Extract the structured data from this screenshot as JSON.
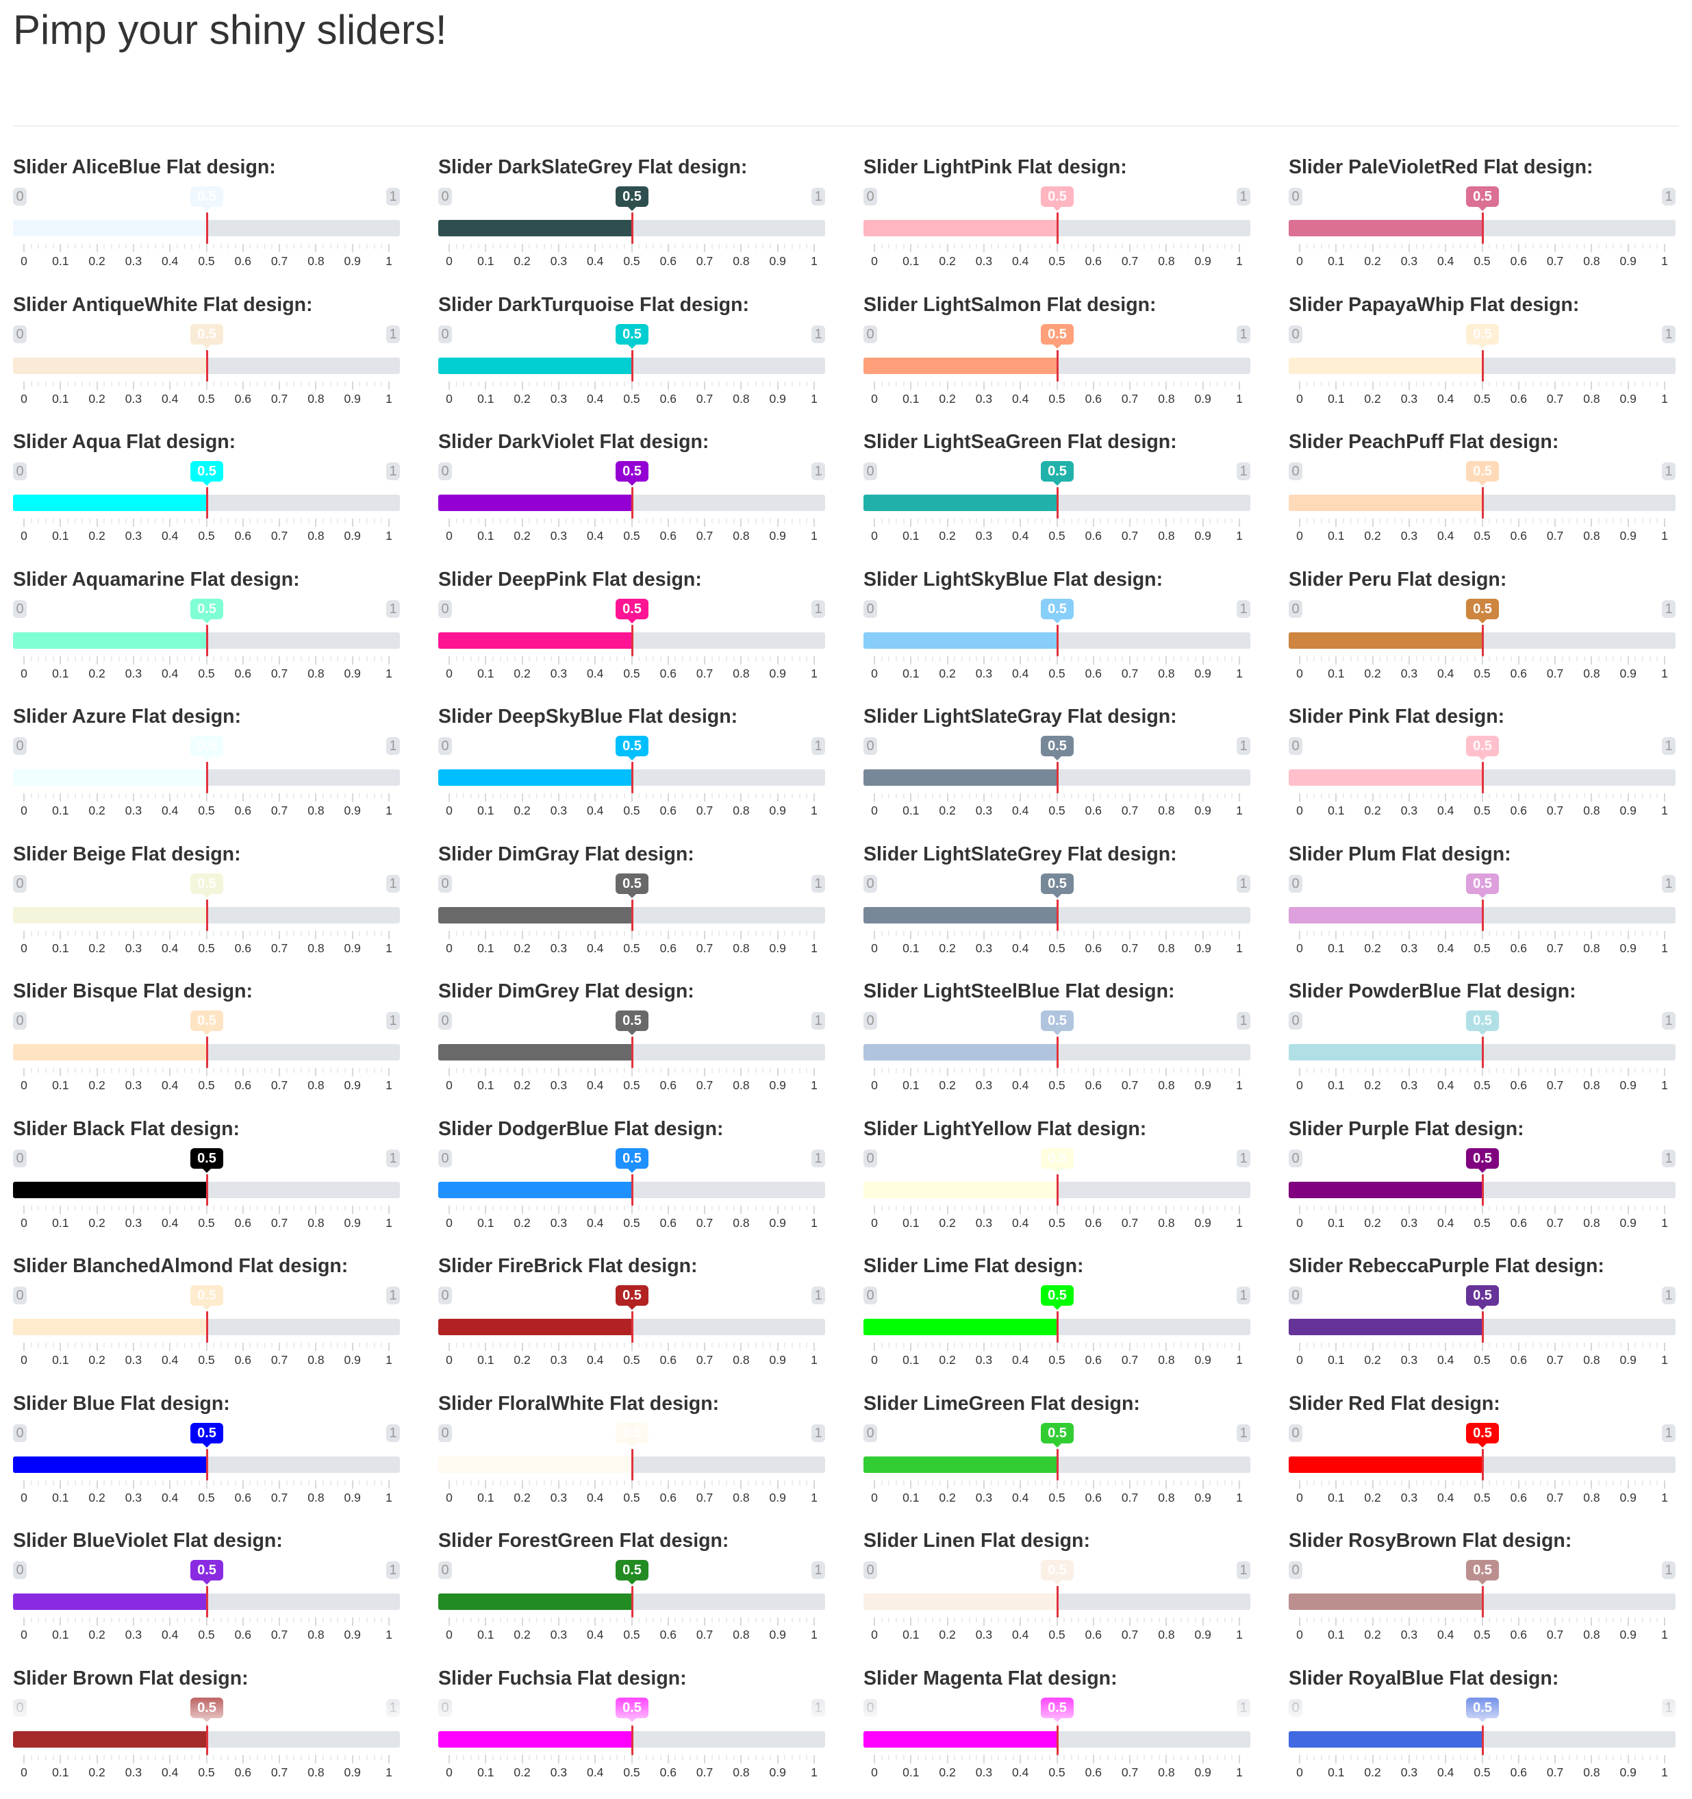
{
  "page": {
    "title": "Pimp your shiny sliders!"
  },
  "slider_common": {
    "min_label": "0",
    "max_label": "1",
    "value_label": "0.5",
    "value": 0.5,
    "scale_labels": [
      "0",
      "0.1",
      "0.2",
      "0.3",
      "0.4",
      "0.5",
      "0.6",
      "0.7",
      "0.8",
      "0.9",
      "1"
    ],
    "track_color": "#e1e4e9",
    "handle_color": "#e1333d"
  },
  "sliders": [
    {
      "title": "Slider AliceBlue Flat design:",
      "color": "#F0F8FF"
    },
    {
      "title": "Slider DarkSlateGrey Flat design:",
      "color": "#2F4F4F"
    },
    {
      "title": "Slider LightPink Flat design:",
      "color": "#FFB6C1"
    },
    {
      "title": "Slider PaleVioletRed Flat design:",
      "color": "#DB7093"
    },
    {
      "title": "Slider AntiqueWhite Flat design:",
      "color": "#FAEBD7"
    },
    {
      "title": "Slider DarkTurquoise Flat design:",
      "color": "#00CED1"
    },
    {
      "title": "Slider LightSalmon Flat design:",
      "color": "#FFA07A"
    },
    {
      "title": "Slider PapayaWhip Flat design:",
      "color": "#FFEFD5"
    },
    {
      "title": "Slider Aqua Flat design:",
      "color": "#00FFFF"
    },
    {
      "title": "Slider DarkViolet Flat design:",
      "color": "#9400D3"
    },
    {
      "title": "Slider LightSeaGreen Flat design:",
      "color": "#20B2AA"
    },
    {
      "title": "Slider PeachPuff Flat design:",
      "color": "#FFDAB9"
    },
    {
      "title": "Slider Aquamarine Flat design:",
      "color": "#7FFFD4"
    },
    {
      "title": "Slider DeepPink Flat design:",
      "color": "#FF1493"
    },
    {
      "title": "Slider LightSkyBlue Flat design:",
      "color": "#87CEFA"
    },
    {
      "title": "Slider Peru Flat design:",
      "color": "#CD853F"
    },
    {
      "title": "Slider Azure Flat design:",
      "color": "#F0FFFF"
    },
    {
      "title": "Slider DeepSkyBlue Flat design:",
      "color": "#00BFFF"
    },
    {
      "title": "Slider LightSlateGray Flat design:",
      "color": "#778899"
    },
    {
      "title": "Slider Pink Flat design:",
      "color": "#FFC0CB"
    },
    {
      "title": "Slider Beige Flat design:",
      "color": "#F5F5DC"
    },
    {
      "title": "Slider DimGray Flat design:",
      "color": "#696969"
    },
    {
      "title": "Slider LightSlateGrey Flat design:",
      "color": "#778899"
    },
    {
      "title": "Slider Plum Flat design:",
      "color": "#DDA0DD"
    },
    {
      "title": "Slider Bisque Flat design:",
      "color": "#FFE4C4"
    },
    {
      "title": "Slider DimGrey Flat design:",
      "color": "#696969"
    },
    {
      "title": "Slider LightSteelBlue Flat design:",
      "color": "#B0C4DE"
    },
    {
      "title": "Slider PowderBlue Flat design:",
      "color": "#B0E0E6"
    },
    {
      "title": "Slider Black Flat design:",
      "color": "#000000"
    },
    {
      "title": "Slider DodgerBlue Flat design:",
      "color": "#1E90FF"
    },
    {
      "title": "Slider LightYellow Flat design:",
      "color": "#FFFFE0"
    },
    {
      "title": "Slider Purple Flat design:",
      "color": "#800080"
    },
    {
      "title": "Slider BlanchedAlmond Flat design:",
      "color": "#FFEBCD"
    },
    {
      "title": "Slider FireBrick Flat design:",
      "color": "#B22222"
    },
    {
      "title": "Slider Lime Flat design:",
      "color": "#00FF00"
    },
    {
      "title": "Slider RebeccaPurple Flat design:",
      "color": "#663399"
    },
    {
      "title": "Slider Blue Flat design:",
      "color": "#0000FF"
    },
    {
      "title": "Slider FloralWhite Flat design:",
      "color": "#FFFAF0"
    },
    {
      "title": "Slider LimeGreen Flat design:",
      "color": "#32CD32"
    },
    {
      "title": "Slider Red Flat design:",
      "color": "#FF0000"
    },
    {
      "title": "Slider BlueViolet Flat design:",
      "color": "#8A2BE2"
    },
    {
      "title": "Slider ForestGreen Flat design:",
      "color": "#228B22"
    },
    {
      "title": "Slider Linen Flat design:",
      "color": "#FAF0E6"
    },
    {
      "title": "Slider RosyBrown Flat design:",
      "color": "#BC8F8F"
    },
    {
      "title": "Slider Brown Flat design:",
      "color": "#A52A2A"
    },
    {
      "title": "Slider Fuchsia Flat design:",
      "color": "#FF00FF"
    },
    {
      "title": "Slider Magenta Flat design:",
      "color": "#FF00FF"
    },
    {
      "title": "Slider RoyalBlue Flat design:",
      "color": "#4169E1"
    }
  ]
}
